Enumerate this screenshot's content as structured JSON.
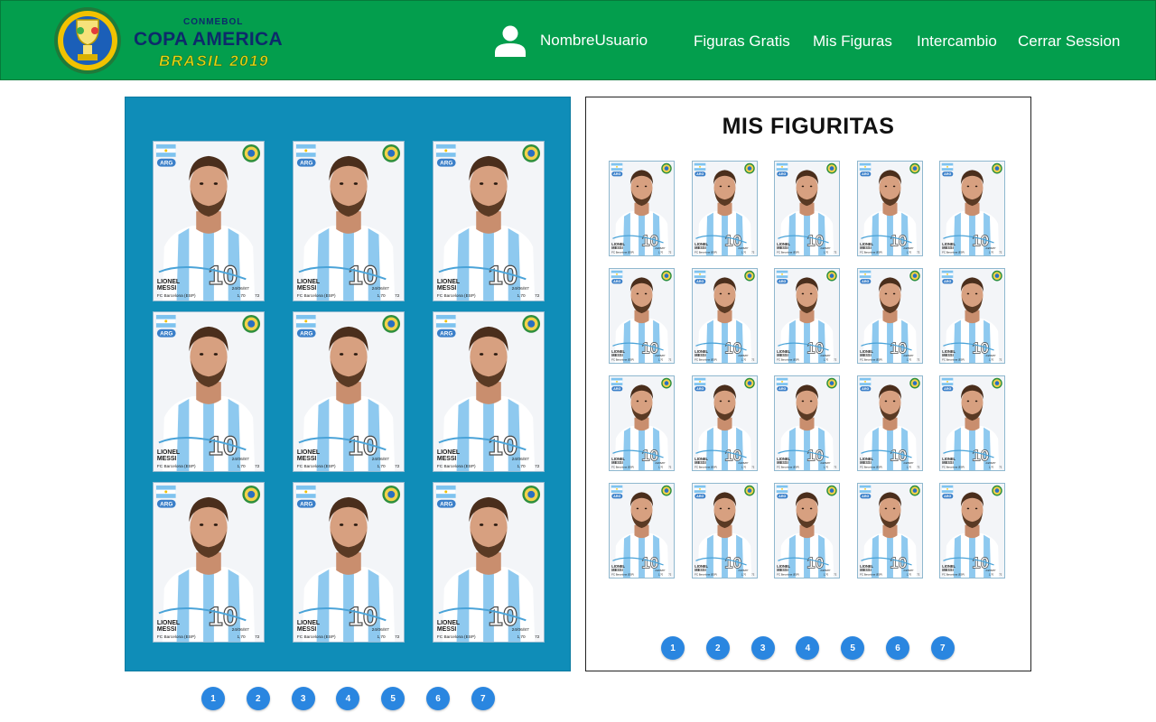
{
  "header": {
    "logo": {
      "small": "CONMEBOL",
      "main": "COPA AMERICA",
      "sub": "BRASIL 2019"
    },
    "user": {
      "icon": "user-icon",
      "name": "NombreUsuario"
    },
    "nav": [
      {
        "label": "Figuras Gratis"
      },
      {
        "label": "Mis Figuras"
      },
      {
        "label": "Intercambio"
      },
      {
        "label": "Cerrar Session"
      }
    ]
  },
  "sticker": {
    "team": "ARG",
    "first_name": "LIONEL",
    "last_name": "MESSI",
    "club": "FC Barcelona (ESP)",
    "birth": "24/06/87",
    "height": "1,70",
    "weight": "72",
    "number": "10"
  },
  "album": {
    "count": 9
  },
  "collection": {
    "title": "MIS FIGURITAS",
    "count": 20
  },
  "pagination": {
    "pages": [
      "1",
      "2",
      "3",
      "4",
      "5",
      "6",
      "7"
    ]
  },
  "colors": {
    "header_green": "#039e4d",
    "panel_blue": "#0f8db8",
    "page_button": "#2a86e0",
    "logo_navy": "#0d2a6b",
    "logo_yellow": "#e8d40f"
  }
}
